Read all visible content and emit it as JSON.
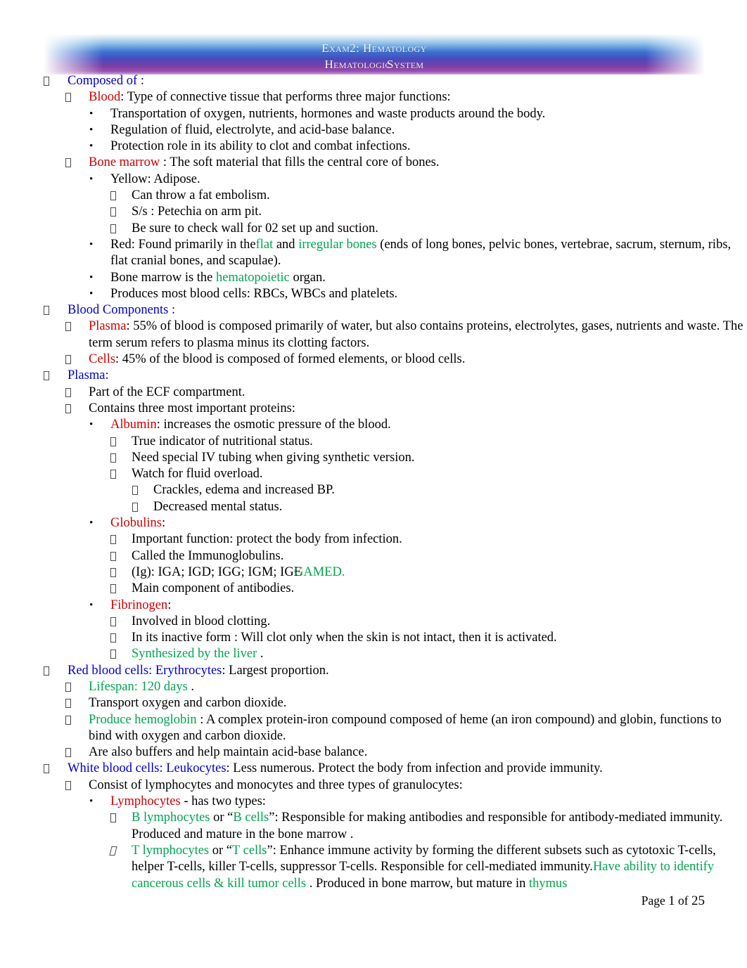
{
  "header": {
    "line1": "Exam2: Hematology",
    "line2_a": "Hematologic",
    "line2_b": "System"
  },
  "footer": {
    "prefix": "Page",
    "page": "1",
    "mid": "of",
    "total": "25"
  },
  "colors": {
    "heading_blue": "#0000CC",
    "term_red": "#CC0000",
    "highlight_green": "#00A550",
    "body_black": "#000000"
  },
  "outline": [
    {
      "id": "composed-of",
      "level": 1,
      "bullet": "tofu",
      "runs": [
        {
          "t": "Composed of",
          "c": "blue"
        },
        {
          "t": " :",
          "c": "blue"
        }
      ]
    },
    {
      "id": "blood",
      "level": 2,
      "bullet": "tofu",
      "runs": [
        {
          "t": "Blood",
          "c": "red"
        },
        {
          "t": ": Type of connective tissue that performs three major functions:",
          "c": "black"
        }
      ]
    },
    {
      "id": "blood-transport",
      "level": 3,
      "bullet": "dot",
      "runs": [
        {
          "t": "Transportation of oxygen, nutrients, hormones and waste products around the body.",
          "c": "black"
        }
      ]
    },
    {
      "id": "blood-regulation",
      "level": 3,
      "bullet": "dot",
      "runs": [
        {
          "t": "Regulation of fluid, electrolyte, and acid-base balance.",
          "c": "black"
        }
      ]
    },
    {
      "id": "blood-protection",
      "level": 3,
      "bullet": "dot",
      "runs": [
        {
          "t": "Protection role in its ability to clot and combat infections.",
          "c": "black"
        }
      ]
    },
    {
      "id": "bone-marrow",
      "level": 2,
      "bullet": "tofu",
      "runs": [
        {
          "t": "Bone marrow",
          "c": "red"
        },
        {
          "t": " : The soft material that fills the central core of bones.",
          "c": "black"
        }
      ]
    },
    {
      "id": "marrow-yellow",
      "level": 3,
      "bullet": "dot",
      "runs": [
        {
          "t": "Yellow: Adipose.",
          "c": "black"
        }
      ]
    },
    {
      "id": "marrow-fat-embolism",
      "level": 4,
      "bullet": "tofu",
      "runs": [
        {
          "t": "Can throw a fat embolism.",
          "c": "black"
        }
      ]
    },
    {
      "id": "marrow-petechia",
      "level": 4,
      "bullet": "tofu",
      "runs": [
        {
          "t": "S/s :  Petechia on arm pit.",
          "c": "black"
        }
      ]
    },
    {
      "id": "marrow-o2-suction",
      "level": 4,
      "bullet": "tofu",
      "runs": [
        {
          "t": "Be sure to check wall for 02 set up and suction.",
          "c": "black"
        }
      ]
    },
    {
      "id": "marrow-red",
      "level": 3,
      "bullet": "dot",
      "runs": [
        {
          "t": "Red: Found primarily in the",
          "c": "black"
        },
        {
          "t": "flat",
          "c": "green"
        },
        {
          "t": " and ",
          "c": "black"
        },
        {
          "t": "irregular bones",
          "c": "green"
        },
        {
          "t": "  (ends of long bones, pelvic bones, vertebrae, sacrum, sternum, ribs, flat cranial bones, and scapulae).",
          "c": "black"
        }
      ]
    },
    {
      "id": "marrow-hematopoietic",
      "level": 3,
      "bullet": "dot",
      "runs": [
        {
          "t": "Bone marrow is the  ",
          "c": "black"
        },
        {
          "t": "hematopoietic",
          "c": "green"
        },
        {
          "t": "  organ.",
          "c": "black"
        }
      ]
    },
    {
      "id": "marrow-produces",
      "level": 3,
      "bullet": "dot",
      "runs": [
        {
          "t": "Produces most blood cells: RBCs, WBCs and platelets.",
          "c": "black"
        }
      ]
    },
    {
      "id": "blood-components",
      "level": 1,
      "bullet": "tofu",
      "runs": [
        {
          "t": "Blood Components",
          "c": "blue"
        },
        {
          "t": " :",
          "c": "blue"
        }
      ]
    },
    {
      "id": "plasma-55",
      "level": 2,
      "bullet": "tofu",
      "runs": [
        {
          "t": "Plasma",
          "c": "red"
        },
        {
          "t": ": 55% of blood is composed primarily of water, but also contains proteins, electrolytes, gases, nutrients and waste. The term serum refers to plasma minus its clotting factors.",
          "c": "black"
        }
      ]
    },
    {
      "id": "cells-45",
      "level": 2,
      "bullet": "tofu",
      "runs": [
        {
          "t": "Cells",
          "c": "red"
        },
        {
          "t": ": 45% of the blood is composed of formed elements, or blood cells.",
          "c": "black"
        }
      ]
    },
    {
      "id": "plasma-heading",
      "level": 1,
      "bullet": "tofu",
      "runs": [
        {
          "t": "Plasma",
          "c": "blue"
        },
        {
          "t": ":",
          "c": "blue"
        }
      ]
    },
    {
      "id": "plasma-ecf",
      "level": 2,
      "bullet": "tofu",
      "runs": [
        {
          "t": "Part of the ECF compartment.",
          "c": "black"
        }
      ]
    },
    {
      "id": "plasma-three-proteins",
      "level": 2,
      "bullet": "tofu",
      "runs": [
        {
          "t": "Contains three  most important proteins:",
          "c": "black"
        }
      ]
    },
    {
      "id": "albumin",
      "level": 3,
      "bullet": "dot",
      "runs": [
        {
          "t": "Albumin",
          "c": "red"
        },
        {
          "t": ": increases the osmotic pressure of the blood.",
          "c": "black"
        }
      ]
    },
    {
      "id": "albumin-nutrition",
      "level": 4,
      "bullet": "tofu",
      "runs": [
        {
          "t": "True indicator of nutritional status.",
          "c": "black"
        }
      ]
    },
    {
      "id": "albumin-iv-tubing",
      "level": 4,
      "bullet": "tofu",
      "runs": [
        {
          "t": "Need special IV tubing when giving synthetic version.",
          "c": "black"
        }
      ]
    },
    {
      "id": "albumin-fluid-overload",
      "level": 4,
      "bullet": "tofu",
      "runs": [
        {
          "t": "Watch for fluid overload.",
          "c": "black"
        }
      ]
    },
    {
      "id": "albumin-crackles",
      "level": 5,
      "bullet": "tofu",
      "runs": [
        {
          "t": "Crackles, edema and increased BP.",
          "c": "black"
        }
      ]
    },
    {
      "id": "albumin-mental-status",
      "level": 5,
      "bullet": "tofu",
      "runs": [
        {
          "t": "Decreased mental status.",
          "c": "black"
        }
      ]
    },
    {
      "id": "globulins",
      "level": 3,
      "bullet": "dot",
      "runs": [
        {
          "t": "Globulins",
          "c": "red"
        },
        {
          "t": ":",
          "c": "black"
        }
      ]
    },
    {
      "id": "globulins-function",
      "level": 4,
      "bullet": "tofu",
      "runs": [
        {
          "t": "Important function: protect the body from infection.",
          "c": "black"
        }
      ]
    },
    {
      "id": "globulins-immunoglobulins",
      "level": 4,
      "bullet": "tofu",
      "runs": [
        {
          "t": "Called the Immunoglobulins.",
          "c": "black"
        }
      ]
    },
    {
      "id": "globulins-ig-list",
      "level": 4,
      "bullet": "tofu",
      "overlap": {
        "base": "(Ig): IGA; IGD; IGG; IGM; IGE",
        "over": "GAMED."
      },
      "runs": [
        {
          "t": "(Ig): IGA; IGD; IGG; IGM; IGE",
          "c": "black"
        }
      ]
    },
    {
      "id": "globulins-antibodies",
      "level": 4,
      "bullet": "tofu",
      "runs": [
        {
          "t": "Main component of antibodies.",
          "c": "black"
        }
      ]
    },
    {
      "id": "fibrinogen",
      "level": 3,
      "bullet": "dot",
      "runs": [
        {
          "t": "Fibrinogen",
          "c": "red"
        },
        {
          "t": ":",
          "c": "black"
        }
      ]
    },
    {
      "id": "fibrinogen-clotting",
      "level": 4,
      "bullet": "tofu",
      "runs": [
        {
          "t": "Involved in blood clotting.",
          "c": "black"
        }
      ]
    },
    {
      "id": "fibrinogen-inactive",
      "level": 4,
      "bullet": "tofu",
      "runs": [
        {
          "t": "In its inactive form : Will clot only when the skin is not intact, then it is activated.",
          "c": "black"
        }
      ]
    },
    {
      "id": "fibrinogen-liver",
      "level": 4,
      "bullet": "tofu",
      "runs": [
        {
          "t": "Synthesized by the liver",
          "c": "green"
        },
        {
          "t": " .",
          "c": "black"
        }
      ]
    },
    {
      "id": "rbc-heading",
      "level": 1,
      "bullet": "tofu",
      "runs": [
        {
          "t": "Red blood cells: Erythrocytes",
          "c": "blue"
        },
        {
          "t": ": Largest proportion.",
          "c": "black"
        }
      ]
    },
    {
      "id": "rbc-lifespan",
      "level": 2,
      "bullet": "tofu",
      "runs": [
        {
          "t": "Lifespan: 120 days",
          "c": "green"
        },
        {
          "t": " .",
          "c": "black"
        }
      ]
    },
    {
      "id": "rbc-transport",
      "level": 2,
      "bullet": "tofu",
      "runs": [
        {
          "t": "Transport oxygen and carbon dioxide.",
          "c": "black"
        }
      ]
    },
    {
      "id": "rbc-hemoglobin",
      "level": 2,
      "bullet": "tofu",
      "runs": [
        {
          "t": "Produce hemoglobin",
          "c": "green"
        },
        {
          "t": " : A complex protein-iron compound composed of heme (an iron compound) and globin, functions to bind with oxygen and carbon dioxide.",
          "c": "black"
        }
      ]
    },
    {
      "id": "rbc-buffers",
      "level": 2,
      "bullet": "tofu",
      "runs": [
        {
          "t": "Are also buffers and help maintain acid-base balance.",
          "c": "black"
        }
      ]
    },
    {
      "id": "wbc-heading",
      "level": 1,
      "bullet": "tofu",
      "runs": [
        {
          "t": "White blood cells: Leukocytes",
          "c": "blue"
        },
        {
          "t": ": Less numerous. Protect the body from infection and provide immunity.",
          "c": "black"
        }
      ]
    },
    {
      "id": "wbc-consist",
      "level": 2,
      "bullet": "tofu",
      "runs": [
        {
          "t": "Consist of lymphocytes and monocytes  and three types of granulocytes:",
          "c": "black"
        }
      ]
    },
    {
      "id": "lymphocytes",
      "level": 3,
      "bullet": "dot",
      "runs": [
        {
          "t": "Lymphocytes",
          "c": "red"
        },
        {
          "t": " - has two types:",
          "c": "black"
        }
      ]
    },
    {
      "id": "b-lymphocytes",
      "level": 4,
      "bullet": "tofu",
      "runs": [
        {
          "t": "B lymphocytes",
          "c": "green"
        },
        {
          "t": " or “",
          "c": "black"
        },
        {
          "t": "B cells",
          "c": "green"
        },
        {
          "t": "”: Responsible for making antibodies and responsible for antibody-mediated immunity. Produced and mature in the bone marrow   .",
          "c": "black"
        }
      ]
    },
    {
      "id": "t-lymphocytes",
      "level": 4,
      "bullet": "tofu-italic",
      "runs": [
        {
          "t": "T lymphocytes",
          "c": "green"
        },
        {
          "t": " or “",
          "c": "black"
        },
        {
          "t": "T cells",
          "c": "green"
        },
        {
          "t": "”: Enhance immune activity by forming the different subsets such as cytotoxic T-cells, helper T-cells, killer T-cells, suppressor T-cells. Responsible for cell-mediated immunity.",
          "c": "black"
        },
        {
          "t": "Have ability to identify cancerous cells & kill tumor cells",
          "c": "green"
        },
        {
          "t": " . Produced in bone marrow, but mature in   ",
          "c": "black"
        },
        {
          "t": "thymus",
          "c": "green"
        }
      ]
    }
  ]
}
